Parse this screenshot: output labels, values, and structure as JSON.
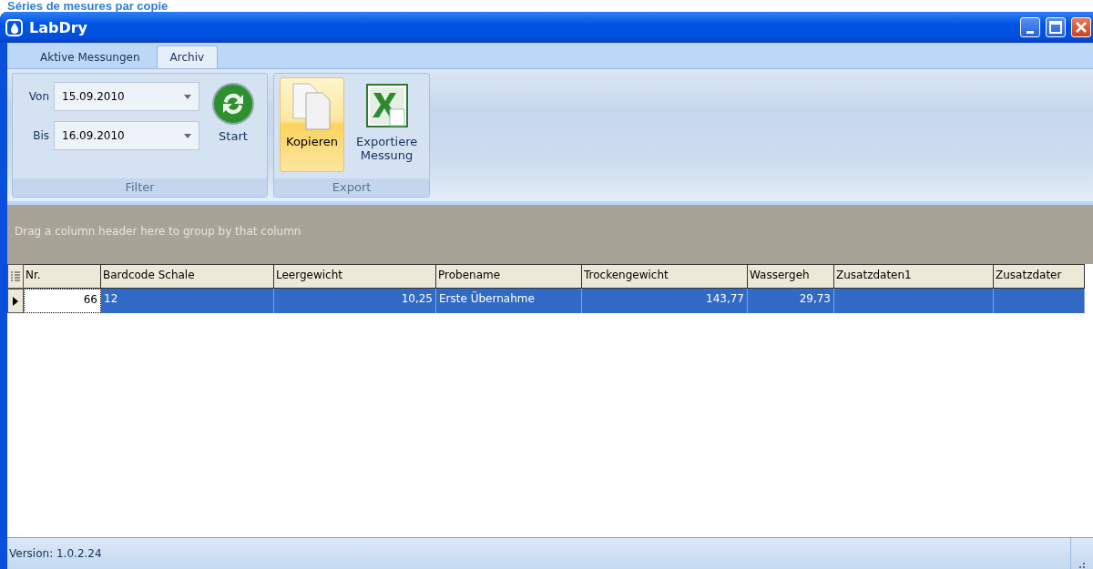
{
  "page_heading": "Séries de mesures par copie",
  "window": {
    "title": "LabDry"
  },
  "tabs": [
    {
      "label": "Aktive Messungen",
      "selected": false
    },
    {
      "label": "Archiv",
      "selected": true
    }
  ],
  "ribbon": {
    "groups": [
      {
        "title": "Filter",
        "fields": [
          {
            "label": "Von",
            "value": "15.09.2010"
          },
          {
            "label": "Bis",
            "value": "16.09.2010"
          }
        ],
        "buttons": [
          {
            "label": "Start",
            "kind": "refresh",
            "highlighted": false
          }
        ]
      },
      {
        "title": "Export",
        "buttons": [
          {
            "label": "Kopieren",
            "kind": "copy",
            "highlighted": true
          },
          {
            "label": "Exportiere\nMessung",
            "kind": "excel",
            "highlighted": false
          }
        ]
      }
    ]
  },
  "group_panel": {
    "hint": "Drag a column header here to group by that column"
  },
  "table": {
    "columns": [
      {
        "label": "Nr.",
        "kind": "number"
      },
      {
        "label": "Bardcode Schale",
        "kind": "text"
      },
      {
        "label": "Leergewicht",
        "kind": "number"
      },
      {
        "label": "Probename",
        "kind": "text"
      },
      {
        "label": "Trockengewicht",
        "kind": "number"
      },
      {
        "label": "Wassergeh",
        "kind": "number"
      },
      {
        "label": "Zusatzdaten1",
        "kind": "text"
      },
      {
        "label": "Zusatzdater",
        "kind": "text"
      }
    ],
    "rows": [
      {
        "selected": true,
        "current": true,
        "cells": [
          "66",
          "12",
          "10,25",
          "Erste Übernahme",
          "143,77",
          "29,73",
          "",
          ""
        ]
      }
    ]
  },
  "status_bar": {
    "text": "Version: 1.0.2.24"
  }
}
